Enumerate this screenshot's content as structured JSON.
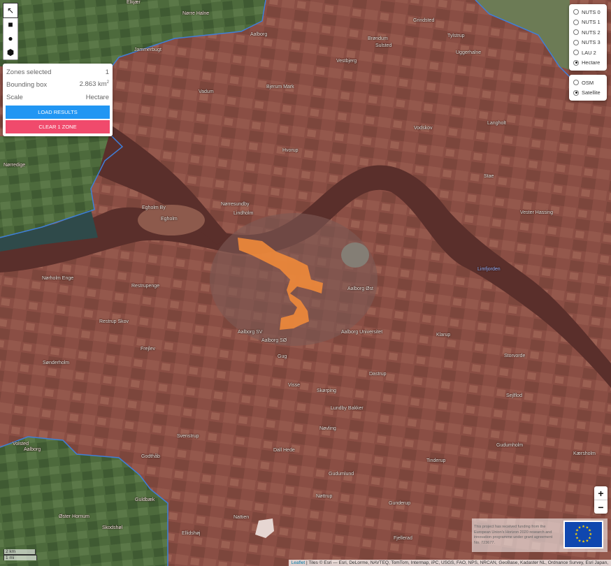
{
  "draw_tools": [
    {
      "name": "select-tool-icon",
      "glyph": "↖",
      "active": true
    },
    {
      "name": "rectangle-tool-icon",
      "glyph": "■",
      "active": false
    },
    {
      "name": "circle-tool-icon",
      "glyph": "●",
      "active": false
    },
    {
      "name": "polygon-tool-icon",
      "glyph": "⬢",
      "active": false
    }
  ],
  "info": {
    "zones_label": "Zones selected",
    "zones_value": "1",
    "bbox_label": "Bounding box",
    "bbox_value": "2.863 km",
    "bbox_unit_sup": "2",
    "scale_label": "Scale",
    "scale_value": "Hectare",
    "load_button": "LOAD RESULTS",
    "clear_button": "CLEAR 1 ZONE"
  },
  "levels": [
    {
      "label": "NUTS 0",
      "selected": false
    },
    {
      "label": "NUTS 1",
      "selected": false
    },
    {
      "label": "NUTS 2",
      "selected": false
    },
    {
      "label": "NUTS 3",
      "selected": false
    },
    {
      "label": "LAU 2",
      "selected": false
    },
    {
      "label": "Hectare",
      "selected": true
    }
  ],
  "basemaps": [
    {
      "label": "OSM",
      "selected": false
    },
    {
      "label": "Satellite",
      "selected": true
    }
  ],
  "zoom": {
    "in": "+",
    "out": "−"
  },
  "eu_notice": "This project has received funding from the European Union's Horizon 2020 research and innovation programme under grant agreement No. 723677.",
  "scale": {
    "km": "2 km",
    "mi": "1 mi"
  },
  "attribution": {
    "leaflet": "Leaflet",
    "tiles": " | Tiles © Esri — Esri, DeLorme, NAVTEQ, TomTom, Intermap, iPC, USGS, FAO, NPS, NRCAN, GeoBase, Kadaster NL, Ordnance Survey, Esri Japan,"
  },
  "colors": {
    "overlay": "#a85a4c",
    "selection": "#f08a3a",
    "boundary": "#3f7fd8"
  },
  "places": [
    {
      "name": "Elkjær",
      "cls": ""
    },
    {
      "name": "Nørre Halne",
      "cls": ""
    },
    {
      "name": "Jammerbugt",
      "cls": ""
    },
    {
      "name": "Aalborg",
      "cls": ""
    },
    {
      "name": "Grindsted",
      "cls": ""
    },
    {
      "name": "Brøndum",
      "cls": ""
    },
    {
      "name": "Sulsted",
      "cls": ""
    },
    {
      "name": "Vestbjerg",
      "cls": ""
    },
    {
      "name": "Tylstrup",
      "cls": ""
    },
    {
      "name": "Uggerhalne",
      "cls": ""
    },
    {
      "name": "Vadum",
      "cls": ""
    },
    {
      "name": "Bjerum Mark",
      "cls": ""
    },
    {
      "name": "Vodskov",
      "cls": ""
    },
    {
      "name": "Langholt",
      "cls": ""
    },
    {
      "name": "Hvorup",
      "cls": ""
    },
    {
      "name": "Nørredige",
      "cls": ""
    },
    {
      "name": "Stae",
      "cls": ""
    },
    {
      "name": "Nørresundby",
      "cls": ""
    },
    {
      "name": "Lindholm",
      "cls": ""
    },
    {
      "name": "Egholm By",
      "cls": ""
    },
    {
      "name": "Egholm",
      "cls": ""
    },
    {
      "name": "Vester Hassing",
      "cls": ""
    },
    {
      "name": "Limfjorden",
      "cls": "blue"
    },
    {
      "name": "Nørholm Enge",
      "cls": ""
    },
    {
      "name": "Restrupenge",
      "cls": ""
    },
    {
      "name": "Aalborg Øst",
      "cls": ""
    },
    {
      "name": "Restrup Skov",
      "cls": ""
    },
    {
      "name": "Aalborg SV",
      "cls": ""
    },
    {
      "name": "Aalborg SØ",
      "cls": ""
    },
    {
      "name": "Aalborg Universitet",
      "cls": ""
    },
    {
      "name": "Frejlev",
      "cls": ""
    },
    {
      "name": "Klarup",
      "cls": ""
    },
    {
      "name": "Sønderholm",
      "cls": ""
    },
    {
      "name": "Gug",
      "cls": ""
    },
    {
      "name": "Storvorde",
      "cls": ""
    },
    {
      "name": "Dastrup",
      "cls": ""
    },
    {
      "name": "Visse",
      "cls": ""
    },
    {
      "name": "Skørping",
      "cls": ""
    },
    {
      "name": "Lundby Bakker",
      "cls": ""
    },
    {
      "name": "Sejlflod",
      "cls": ""
    },
    {
      "name": "Nøvling",
      "cls": ""
    },
    {
      "name": "Svenstrup",
      "cls": ""
    },
    {
      "name": "Dall Hede",
      "cls": ""
    },
    {
      "name": "Gudumholm",
      "cls": ""
    },
    {
      "name": "Godthåb",
      "cls": ""
    },
    {
      "name": "Ellidshøj",
      "cls": ""
    },
    {
      "name": "Tinderup",
      "cls": ""
    },
    {
      "name": "Kærsholm",
      "cls": ""
    },
    {
      "name": "Gunderup",
      "cls": ""
    },
    {
      "name": "Guldbæk",
      "cls": ""
    },
    {
      "name": "Øster Hornum",
      "cls": ""
    },
    {
      "name": "Skodshøl",
      "cls": ""
    },
    {
      "name": "Nøttrup",
      "cls": ""
    },
    {
      "name": "Nattien",
      "cls": ""
    },
    {
      "name": "Fjellerad",
      "cls": ""
    },
    {
      "name": "Volsted",
      "cls": ""
    },
    {
      "name": "Aalborg",
      "cls": ""
    },
    {
      "name": "Gudumlund",
      "cls": ""
    }
  ]
}
